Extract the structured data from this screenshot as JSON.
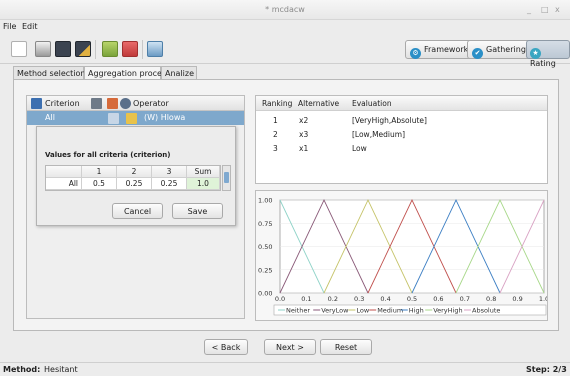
{
  "window": {
    "title": "* mcdacw",
    "minimize": "_",
    "maximize": "□",
    "close": "x"
  },
  "menu": {
    "file": "File",
    "edit": "Edit"
  },
  "toolbar": {
    "icons": [
      "new-file",
      "open-folder",
      "save",
      "save-as",
      "import",
      "export",
      "help"
    ],
    "phases": [
      {
        "label": "Framework",
        "color": "#2a8fc7"
      },
      {
        "label": "Gathering",
        "color": "#2a8fc7"
      },
      {
        "label": "Rating",
        "color": "#3aa6c2"
      }
    ]
  },
  "tabs": [
    "Method selection",
    "Aggregation process",
    "Analize"
  ],
  "criteria_panel": {
    "header_criterion": "Criterion",
    "header_operator": "Operator",
    "row_name": "All",
    "row_operator": "(W) Hlowa"
  },
  "dialog": {
    "title": "Values for all criteria (criterion)",
    "columns": [
      "",
      "1",
      "2",
      "3",
      "Sum"
    ],
    "row": [
      "All",
      "0.5",
      "0.25",
      "0.25",
      "1.0"
    ],
    "cancel": "Cancel",
    "save": "Save"
  },
  "ranking": {
    "columns": [
      "Ranking",
      "Alternative",
      "Evaluation"
    ],
    "rows": [
      [
        "1",
        "x2",
        "[VeryHigh,Absolute]"
      ],
      [
        "2",
        "x3",
        "[Low,Medium]"
      ],
      [
        "3",
        "x1",
        "Low"
      ]
    ]
  },
  "chart_data": {
    "type": "line",
    "xlim": [
      0.0,
      1.0
    ],
    "ylim": [
      0.0,
      1.0
    ],
    "x_ticks": [
      "0.0",
      "0.1",
      "0.2",
      "0.3",
      "0.4",
      "0.5",
      "0.6",
      "0.7",
      "0.8",
      "0.9",
      "1.0"
    ],
    "y_ticks": [
      "0.00",
      "0.25",
      "0.50",
      "0.75",
      "1.00"
    ],
    "legend_position": "bottom",
    "series": [
      {
        "name": "Neither",
        "color": "#8fd3c8",
        "x": [
          0.0,
          0.1667
        ],
        "y": [
          1,
          0
        ]
      },
      {
        "name": "VeryLow",
        "color": "#8a5a78",
        "x": [
          0.0,
          0.1667,
          0.3333
        ],
        "y": [
          0,
          1,
          0
        ]
      },
      {
        "name": "Low",
        "color": "#c6c46a",
        "x": [
          0.1667,
          0.3333,
          0.5
        ],
        "y": [
          0,
          1,
          0
        ]
      },
      {
        "name": "Medium",
        "color": "#c0504d",
        "x": [
          0.3333,
          0.5,
          0.6667
        ],
        "y": [
          0,
          1,
          0
        ]
      },
      {
        "name": "High",
        "color": "#3d7fc4",
        "x": [
          0.5,
          0.6667,
          0.8333
        ],
        "y": [
          0,
          1,
          0
        ]
      },
      {
        "name": "VeryHigh",
        "color": "#a8d88a",
        "x": [
          0.6667,
          0.8333,
          1.0
        ],
        "y": [
          0,
          1,
          0
        ]
      },
      {
        "name": "Absolute",
        "color": "#d9a3c4",
        "x": [
          0.8333,
          1.0
        ],
        "y": [
          0,
          1
        ]
      }
    ]
  },
  "nav": {
    "back": "< Back",
    "next": "Next >",
    "reset": "Reset"
  },
  "status": {
    "method_label": "Method:",
    "method_value": "Hesitant",
    "step": "Step: 2/3"
  }
}
